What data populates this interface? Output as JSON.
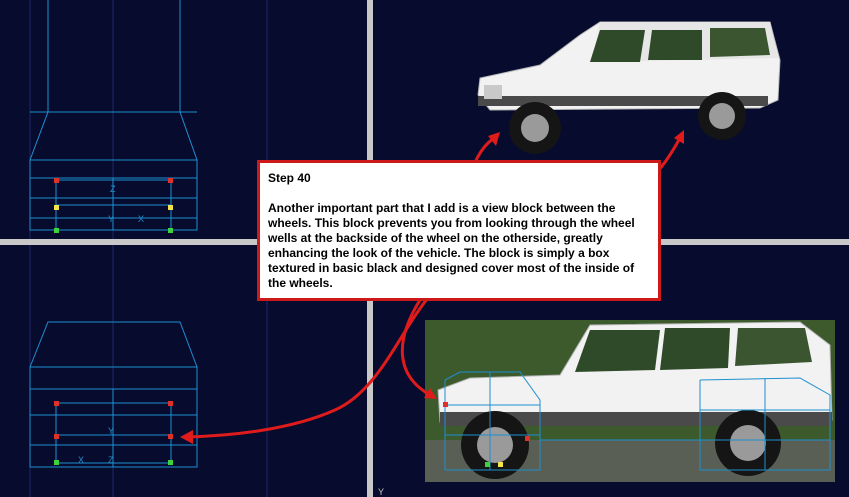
{
  "note": {
    "title": "Step 40",
    "body": "Another important part that I add is  a view block between the wheels. This block prevents you from looking through the wheel wells at the backside of the wheel on the otherside, greatly enhancing the look of the vehicle. The block is simply a box textured in basic black and designed cover most of the inside of the wheels."
  },
  "top_left_view": {
    "axis_labels": [
      "Z",
      "Y",
      "X"
    ]
  },
  "bottom_left_view": {
    "axis_labels": [
      "Y",
      "X",
      "Z"
    ]
  },
  "bottom_right_view": {
    "axis_label": "Y"
  },
  "colors": {
    "background": "#070b2e",
    "wireframe": "#1e8fd0",
    "grid": "#1c2a6a",
    "divider": "#c8c8c8",
    "accent_red": "#cc1a1a",
    "vertex_red": "#e0302a",
    "vertex_yellow": "#f2e64a",
    "vertex_green": "#3ed33e"
  }
}
